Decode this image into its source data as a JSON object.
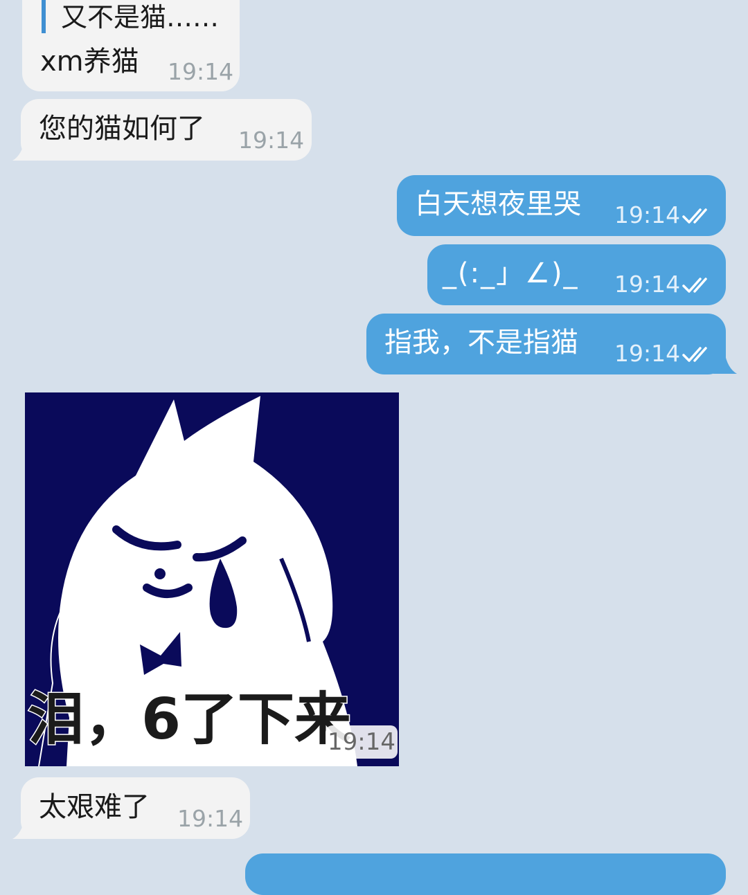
{
  "messages": [
    {
      "id": "m1",
      "side": "in",
      "quote": "又不是猫……",
      "text": "xm养猫",
      "time": "19:14"
    },
    {
      "id": "m2",
      "side": "in",
      "text": "您的猫如何了",
      "time": "19:14"
    },
    {
      "id": "m3",
      "side": "out",
      "text": "白天想夜里哭",
      "time": "19:14",
      "read": true
    },
    {
      "id": "m4",
      "side": "out",
      "text": "_(:_」∠)_",
      "time": "19:14",
      "read": true
    },
    {
      "id": "m5",
      "side": "out",
      "text": "指我，不是指猫",
      "time": "19:14",
      "read": true
    },
    {
      "id": "m6",
      "side": "in",
      "type": "sticker",
      "caption": "泪，6了下来",
      "time": "19:14"
    },
    {
      "id": "m7",
      "side": "in",
      "text": "太艰难了",
      "time": "19:14"
    }
  ],
  "colors": {
    "background": "#d6e0eb",
    "incoming_bubble": "#f3f3f3",
    "outgoing_bubble": "#4fa3de",
    "sticker_background": "#0a0a5a"
  },
  "icons": {
    "read_receipt": "double-check-icon"
  }
}
